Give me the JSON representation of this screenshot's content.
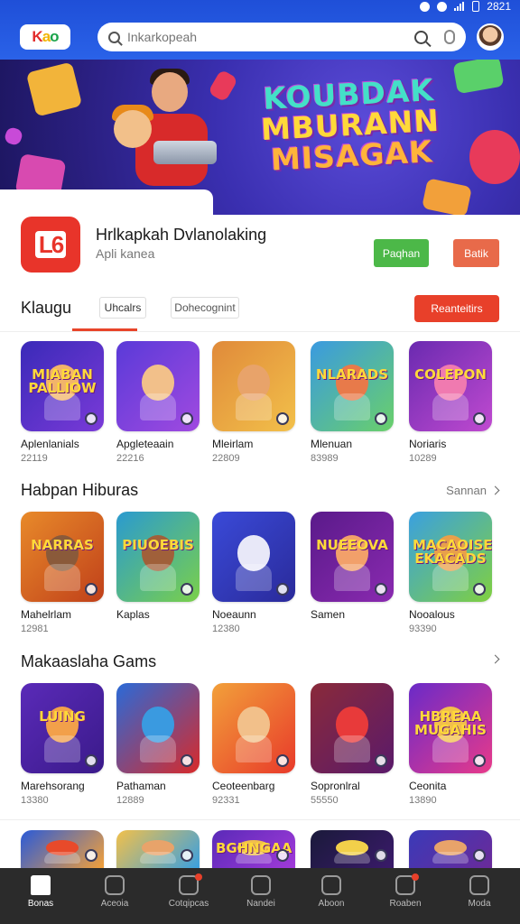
{
  "status_bar": {
    "time": "2821"
  },
  "header": {
    "logo_text": "Kao",
    "search_placeholder": "Inkarkopeah"
  },
  "banner": {
    "title_lines": [
      "KOUBDAK",
      "MBURANN",
      "MISAGAK"
    ]
  },
  "app_card": {
    "icon_text": "L6",
    "name": "Hrlkapkah Dvlanolaking",
    "subtitle": "Apli kanea",
    "primary_button": "Paqhan",
    "secondary_button": "Batik"
  },
  "tabs": {
    "title": "Klaugu",
    "chip1": "Uhcalrs",
    "chip2": "Dohecognint",
    "cta": "Reanteitirs"
  },
  "section1": {
    "items": [
      {
        "name": "Aplenlanials",
        "count": "22119",
        "thumb_title": "MIABAN PALLIOW",
        "colors": [
          "#3a2ab8",
          "#7a3ad8"
        ],
        "hero": "#f2b46a"
      },
      {
        "name": "Apgleteaain",
        "count": "22216",
        "thumb_title": "",
        "colors": [
          "#5a3ad8",
          "#a04ae0"
        ],
        "hero": "#f2c08a"
      },
      {
        "name": "Mleirlam",
        "count": "22809",
        "thumb_title": "",
        "colors": [
          "#e08a3a",
          "#f2c04a"
        ],
        "hero": "#e8a36a"
      },
      {
        "name": "Mlenuan",
        "count": "83989",
        "thumb_title": "NLARADS",
        "colors": [
          "#3a9ae0",
          "#6ad06a"
        ],
        "hero": "#e87a4a"
      },
      {
        "name": "Noriaris",
        "count": "10289",
        "thumb_title": "COLEPON",
        "colors": [
          "#6a2ab0",
          "#c04ad0"
        ],
        "hero": "#f07ab0"
      }
    ]
  },
  "section2": {
    "title": "Habpan Hiburas",
    "more": "Sannan",
    "items": [
      {
        "name": "Mahelrlam",
        "count": "12981",
        "thumb_title": "NARRAS",
        "colors": [
          "#e88a2a",
          "#c0401a"
        ],
        "hero": "#8a5a3a"
      },
      {
        "name": "Kaplas",
        "count": "",
        "thumb_title": "PIUOEBIS",
        "colors": [
          "#2a9ad0",
          "#7ad04a"
        ],
        "hero": "#a0603a"
      },
      {
        "name": "Noeaunn",
        "count": "12380",
        "thumb_title": "",
        "colors": [
          "#3a4ad8",
          "#2a2a9a"
        ],
        "hero": "#e8e8f8"
      },
      {
        "name": "Samen",
        "count": "",
        "thumb_title": "NUEEOVA",
        "colors": [
          "#5a1a8a",
          "#8a2ab0"
        ],
        "hero": "#f2a06a"
      },
      {
        "name": "Nooalous",
        "count": "93390",
        "thumb_title": "MACAOISE EKACADS",
        "colors": [
          "#3aa0e0",
          "#80d040"
        ],
        "hero": "#e8a04a"
      }
    ]
  },
  "section3": {
    "title": "Makaaslaha Gams",
    "items": [
      {
        "name": "Marehsorang",
        "count": "13380",
        "thumb_title": "LUING",
        "colors": [
          "#5a2ab8",
          "#3a1a8a"
        ],
        "hero": "#f2a04a"
      },
      {
        "name": "Pathaman",
        "count": "12889",
        "thumb_title": "",
        "colors": [
          "#2a6ad8",
          "#d82a2a"
        ],
        "hero": "#3a9ae0"
      },
      {
        "name": "Ceoteenbarg",
        "count": "92331",
        "thumb_title": "",
        "colors": [
          "#f2a03a",
          "#e83a2a"
        ],
        "hero": "#f2c08a"
      },
      {
        "name": "Sopronlral",
        "count": "55550",
        "thumb_title": "",
        "colors": [
          "#8a2a3a",
          "#5a1a6a"
        ],
        "hero": "#e83a3a"
      },
      {
        "name": "Ceonita",
        "count": "13890",
        "thumb_title": "HBREAA MUGAHIS",
        "colors": [
          "#6a2ac8",
          "#e83a8a"
        ],
        "hero": "#f2c04a"
      }
    ]
  },
  "section4": {
    "items": [
      {
        "colors": [
          "#2a5ad8",
          "#f2a03a"
        ],
        "hero": "#e84a2a"
      },
      {
        "colors": [
          "#f2c04a",
          "#3aa0e0"
        ],
        "hero": "#e8a36a"
      },
      {
        "colors": [
          "#5a2ab8",
          "#a03ad8"
        ],
        "hero": "#f2c04a",
        "thumb_title": "BGHNGAA"
      },
      {
        "colors": [
          "#1a1a3a",
          "#3a1a6a"
        ],
        "hero": "#f2d04a"
      },
      {
        "colors": [
          "#3a3ab8",
          "#6a2a9a"
        ],
        "hero": "#e8a36a"
      }
    ]
  },
  "bottom_nav": [
    {
      "label": "Bonas",
      "active": true
    },
    {
      "label": "Aceoia",
      "active": false
    },
    {
      "label": "Cotqipcas",
      "active": false,
      "dot": true
    },
    {
      "label": "Nandei",
      "active": false
    },
    {
      "label": "Aboon",
      "active": false
    },
    {
      "label": "Roaben",
      "active": false,
      "dot": true
    },
    {
      "label": "Moda",
      "active": false
    }
  ]
}
